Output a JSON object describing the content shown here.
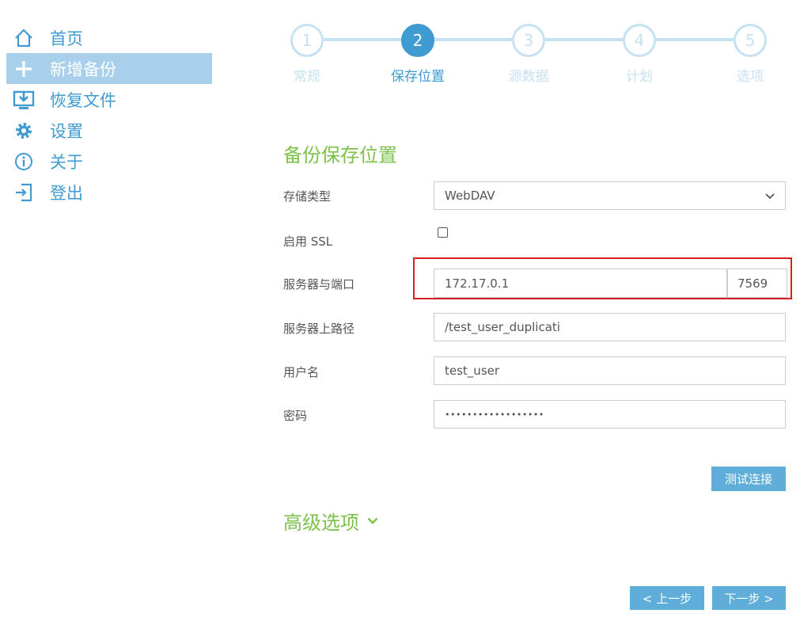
{
  "sidebar": {
    "items": [
      {
        "label": "首页",
        "icon": "home-icon"
      },
      {
        "label": "新增备份",
        "icon": "plus-icon"
      },
      {
        "label": "恢复文件",
        "icon": "restore-icon"
      },
      {
        "label": "设置",
        "icon": "gear-icon"
      },
      {
        "label": "关于",
        "icon": "info-icon"
      },
      {
        "label": "登出",
        "icon": "logout-icon"
      }
    ],
    "active_index": 1
  },
  "stepper": {
    "active_index": 1,
    "steps": [
      {
        "number": "1",
        "label": "常规"
      },
      {
        "number": "2",
        "label": "保存位置"
      },
      {
        "number": "3",
        "label": "源数据"
      },
      {
        "number": "4",
        "label": "计划"
      },
      {
        "number": "5",
        "label": "选项"
      }
    ]
  },
  "form": {
    "title": "备份保存位置",
    "storage_type": {
      "label": "存储类型",
      "value": "WebDAV"
    },
    "ssl": {
      "label": "启用 SSL",
      "checked": false
    },
    "server": {
      "label": "服务器与端口",
      "host": "172.17.0.1",
      "port": "7569"
    },
    "path": {
      "label": "服务器上路径",
      "value": "/test_user_duplicati"
    },
    "username": {
      "label": "用户名",
      "value": "test_user"
    },
    "password": {
      "label": "密码",
      "value": "••••••••••••••••••"
    }
  },
  "buttons": {
    "test_connection": "测试连接",
    "advanced_options": "高级选项",
    "previous": "< 上一步",
    "next": "下一步 >"
  },
  "colors": {
    "accent": "#3f9bd2",
    "accent_light": "#c6e2f2",
    "active_bg": "#a8d0ea",
    "green": "#7dc24b",
    "button": "#5fadd9",
    "highlight": "#d42020"
  }
}
